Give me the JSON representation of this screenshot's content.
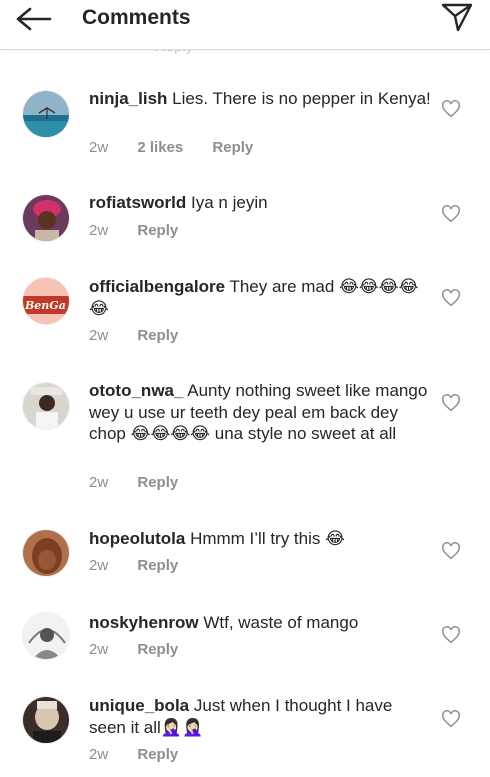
{
  "header": {
    "title": "Comments",
    "back_icon": "arrow-left-icon",
    "send_icon": "paper-plane-icon"
  },
  "labels": {
    "reply": "Reply"
  },
  "previous": {
    "reply": "Reply"
  },
  "comments": [
    {
      "user": "ninja_lish",
      "text": "Lies. There is no pepper in Kenya!",
      "time": "2w",
      "likes": "2 likes"
    },
    {
      "user": "rofiatsworld",
      "text": "Iya n jeyin",
      "time": "2w"
    },
    {
      "user": "officialbengalore",
      "text": "They are mad 😂😂😂😂😂",
      "time": "2w",
      "avatar_text": "BenGa"
    },
    {
      "user": "ototo_nwa_",
      "text": "Aunty nothing sweet like mango wey u use ur teeth dey peal em back dey chop 😂😂😂😂 una style no sweet at all",
      "time": "2w"
    },
    {
      "user": "hopeolutola",
      "text": "Hmmm I’ll try this 😂",
      "time": "2w"
    },
    {
      "user": "noskyhenrow",
      "text": "Wtf, waste of mango",
      "time": "2w"
    },
    {
      "user": "unique_bola",
      "text": "Just when I thought I have seen it all🤦🏻‍♀️🤦🏻‍♀️",
      "time": "2w"
    }
  ],
  "colors": {
    "text": "#262626",
    "meta": "#8e8e8e",
    "divider": "#dbdbdb"
  }
}
